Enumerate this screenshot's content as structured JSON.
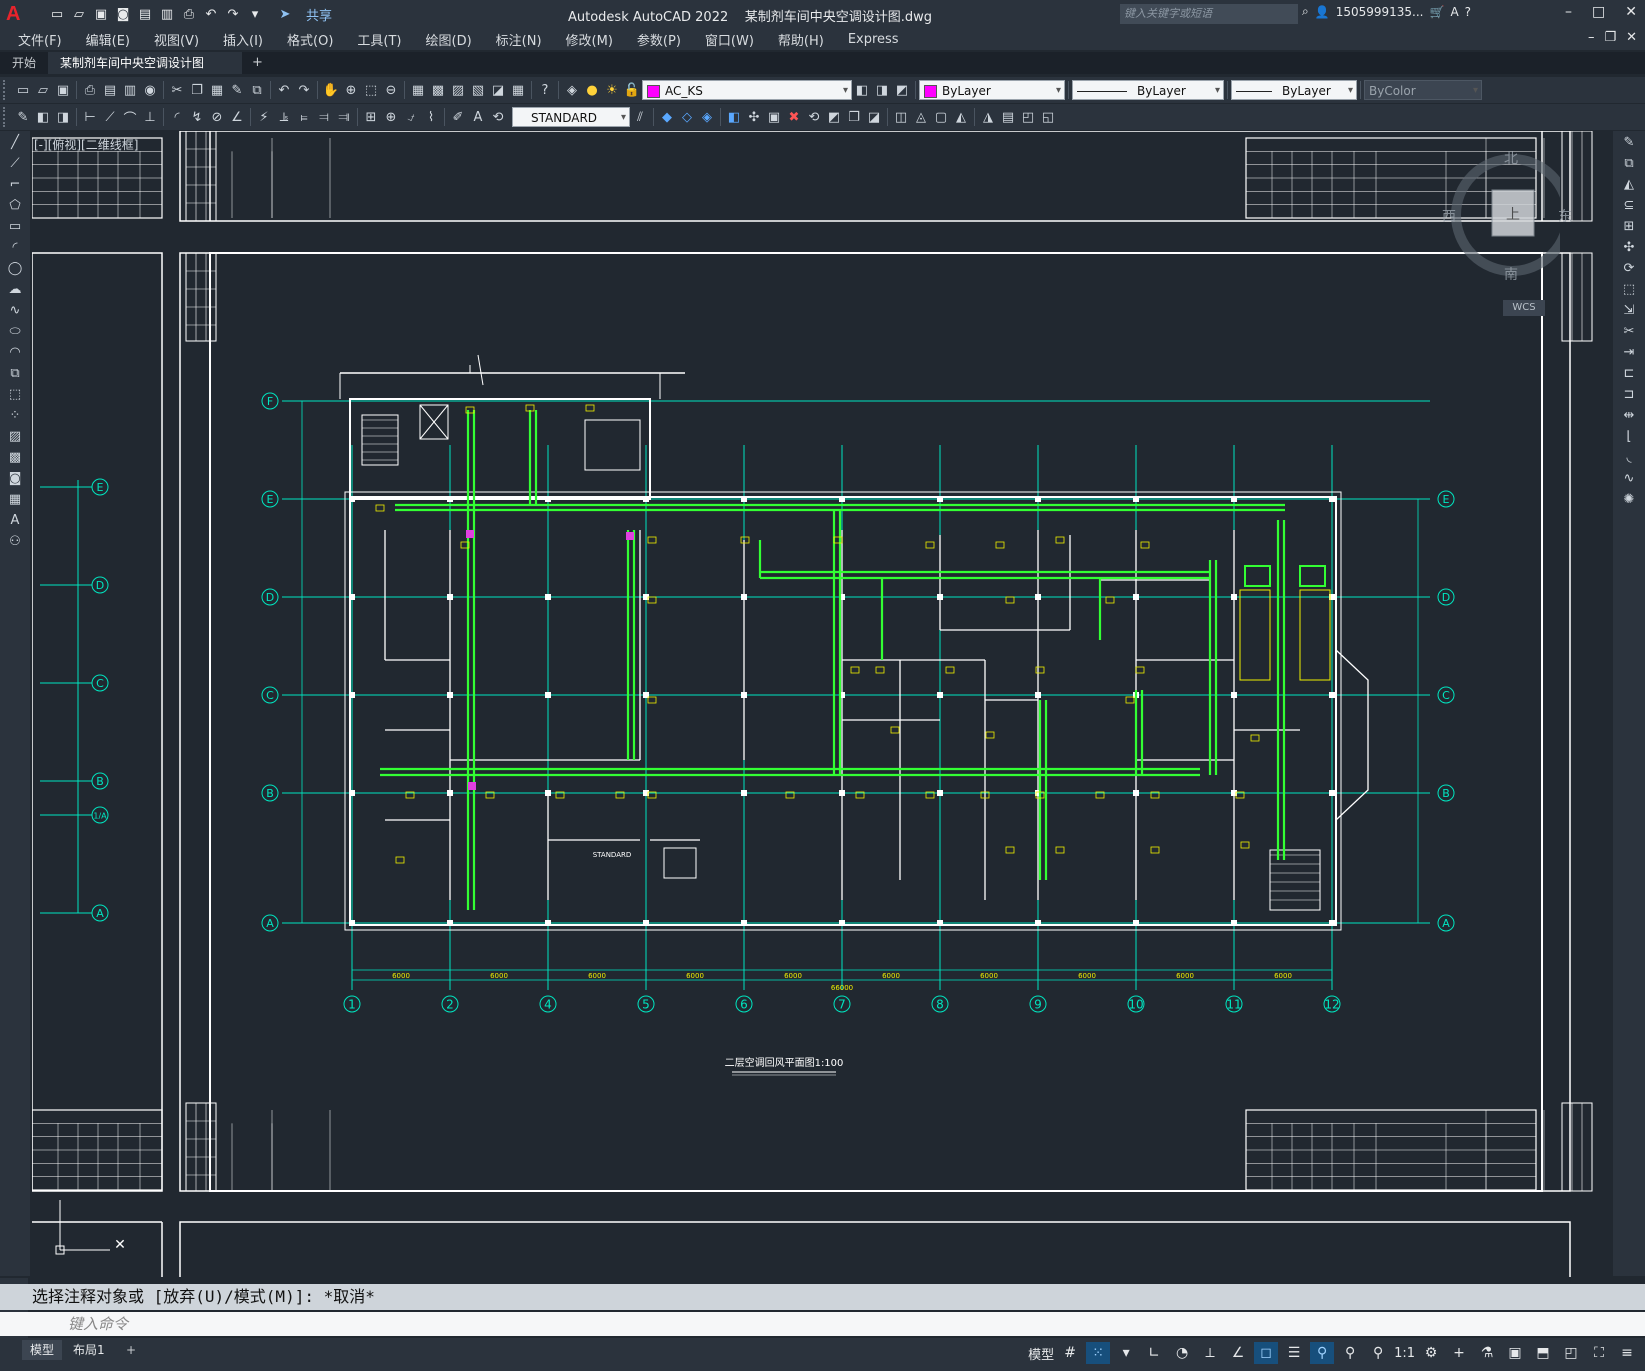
{
  "app": {
    "title": "Autodesk AutoCAD 2022    某制剂车间中央空调设计图.dwg",
    "share_label": "共享",
    "search_placeholder": "键入关键字或短语",
    "user": "1505999135...",
    "logo": "A"
  },
  "menu": [
    "文件(F)",
    "编辑(E)",
    "视图(V)",
    "插入(I)",
    "格式(O)",
    "工具(T)",
    "绘图(D)",
    "标注(N)",
    "修改(M)",
    "参数(P)",
    "窗口(W)",
    "帮助(H)",
    "Express"
  ],
  "tabs": {
    "start": "开始",
    "active": "某制剂车间中央空调设计图*",
    "add": "+"
  },
  "toolbar": {
    "layer": "AC_KS",
    "color": "ByLayer",
    "linetype": "ByLayer",
    "lineweight": "ByLayer",
    "plotstyle": "ByColor",
    "textstyle": "STANDARD"
  },
  "viewport": {
    "label": "[-][俯视][二维线框]",
    "viewcube": {
      "north": "北",
      "south": "南",
      "west": "西",
      "east": "东",
      "top": "上"
    },
    "wcs": "WCS"
  },
  "drawing": {
    "title": "二层空调回风平面图1:100",
    "grid_cols": [
      "1",
      "2",
      "4",
      "5",
      "6",
      "7",
      "8",
      "9",
      "10",
      "11",
      "12"
    ],
    "grid_rows": [
      "F",
      "E",
      "D",
      "C",
      "B",
      "A"
    ],
    "side_rows": [
      "E",
      "D",
      "C",
      "B",
      "1/A",
      "A"
    ],
    "span_label": "6000",
    "total_label": "66000",
    "room_label": "STANDARD"
  },
  "command": {
    "history": "选择注释对象或 [放弃(U)/模式(M)]: *取消*",
    "placeholder": "键入命令"
  },
  "layout_tabs": {
    "model": "模型",
    "layout1": "布局1",
    "add": "+"
  },
  "status": {
    "model_label": "模型",
    "scale": "1:1"
  },
  "colors": {
    "background": "#212830",
    "chrome": "#2b333d",
    "grid": "#00e5c0",
    "duct": "#33ff33",
    "annotation": "#f0f000",
    "wall": "#ffffff",
    "accent": "#e8242c"
  }
}
